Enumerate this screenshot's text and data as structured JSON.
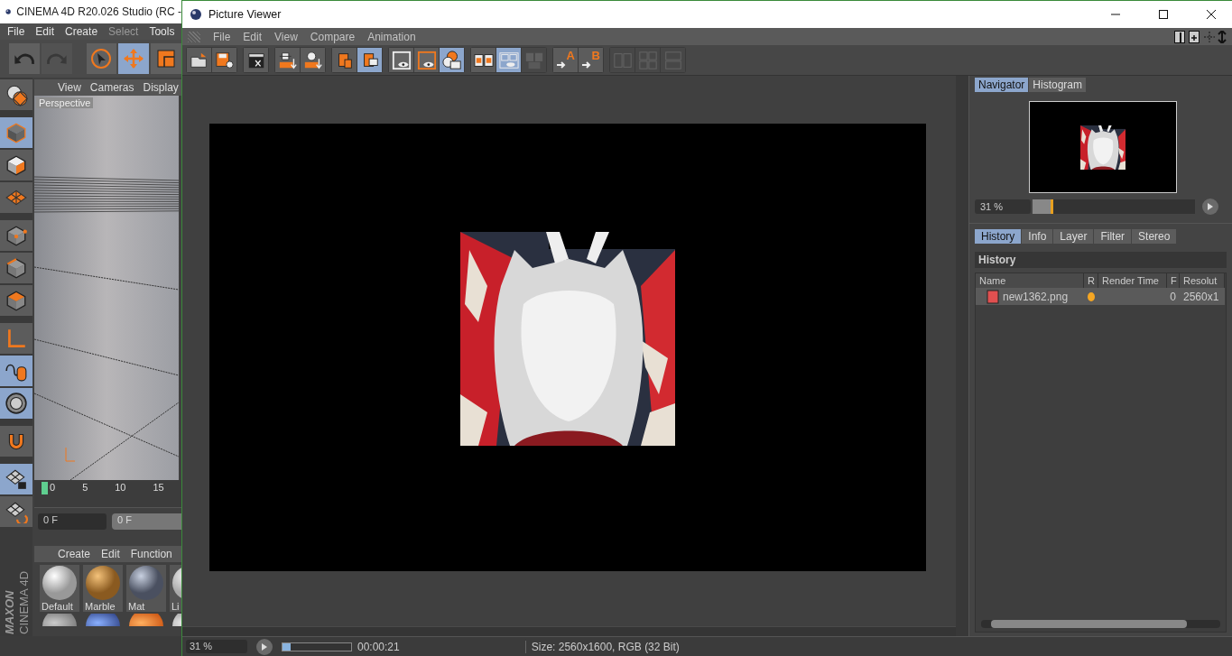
{
  "main_window": {
    "title": "CINEMA 4D R20.026 Studio (RC -",
    "menu": [
      {
        "label": "File",
        "disabled": false
      },
      {
        "label": "Edit",
        "disabled": false
      },
      {
        "label": "Create",
        "disabled": false
      },
      {
        "label": "Select",
        "disabled": true
      },
      {
        "label": "Tools",
        "disabled": false
      }
    ],
    "toolbar": [
      {
        "selected": false,
        "disabled": false
      },
      {
        "selected": false,
        "disabled": true
      },
      {
        "selected": false,
        "disabled": false
      },
      {
        "selected": true,
        "disabled": false
      },
      {
        "selected": false,
        "disabled": false
      }
    ],
    "palette": [
      {
        "selected": false
      },
      {
        "selected": true
      },
      {
        "selected": false
      },
      {
        "selected": false
      },
      {
        "selected": false
      },
      {
        "selected": false
      },
      {
        "selected": false
      },
      {
        "selected": false
      },
      {
        "selected": true
      },
      {
        "selected": true
      },
      {
        "selected": false
      },
      {
        "selected": true
      },
      {
        "selected": false
      }
    ],
    "viewport": {
      "menu": [
        "View",
        "Cameras",
        "Display"
      ],
      "label": "Perspective"
    },
    "timeline": {
      "ticks": [
        "0",
        "5",
        "10",
        "15"
      ]
    },
    "frame_fields": [
      "0 F",
      "0 F"
    ],
    "material_manager": {
      "menu": [
        "Create",
        "Edit",
        "Function"
      ],
      "materials": [
        {
          "name": "Default"
        },
        {
          "name": "Marble"
        },
        {
          "name": "Mat"
        },
        {
          "name": "Li"
        }
      ]
    },
    "logo": [
      "MAXON",
      "CINEMA 4D"
    ]
  },
  "picture_viewer": {
    "title": "Picture Viewer",
    "menu": [
      "File",
      "Edit",
      "View",
      "Compare",
      "Animation"
    ],
    "toolbar": [
      [
        {
          "on": false,
          "disabled": false
        },
        {
          "on": false,
          "disabled": false
        }
      ],
      [
        {
          "on": false,
          "disabled": false
        }
      ],
      [
        {
          "on": false,
          "disabled": false
        },
        {
          "on": false,
          "disabled": false
        }
      ],
      [
        {
          "on": false,
          "disabled": false
        },
        {
          "on": true,
          "disabled": false
        }
      ],
      [
        {
          "on": false,
          "disabled": false
        },
        {
          "on": false,
          "disabled": false
        },
        {
          "on": true,
          "disabled": false
        }
      ],
      [
        {
          "on": false,
          "disabled": false
        },
        {
          "on": true,
          "disabled": false
        },
        {
          "on": false,
          "disabled": true
        }
      ],
      [
        {
          "on": false,
          "disabled": false,
          "label": "A"
        },
        {
          "on": false,
          "disabled": false,
          "label": "B"
        }
      ],
      [
        {
          "on": false,
          "disabled": true
        },
        {
          "on": false,
          "disabled": true
        },
        {
          "on": false,
          "disabled": true
        }
      ]
    ],
    "navigator": {
      "tabs": [
        {
          "label": "Navigator",
          "selected": true
        },
        {
          "label": "Histogram",
          "selected": false
        }
      ],
      "zoom": "31 %",
      "zoom_slider": {
        "level": 0.13
      }
    },
    "history": {
      "tabs": [
        {
          "label": "History",
          "selected": true
        },
        {
          "label": "Info",
          "selected": false
        },
        {
          "label": "Layer",
          "selected": false
        },
        {
          "label": "Filter",
          "selected": false
        },
        {
          "label": "Stereo",
          "selected": false
        }
      ],
      "heading": "History",
      "columns": [
        "Name",
        "R",
        "Render Time",
        "F",
        "Resolut"
      ],
      "rows": [
        {
          "name": "new1362.png",
          "color": "#f5a623",
          "frame": "0",
          "resolution": "2560x1",
          "selected": true
        }
      ]
    },
    "status_bar": {
      "zoom": "31 %",
      "progress": {
        "level": 0.12
      },
      "time": "00:00:21",
      "info": "Size: 2560x1600, RGB (32 Bit)"
    }
  }
}
